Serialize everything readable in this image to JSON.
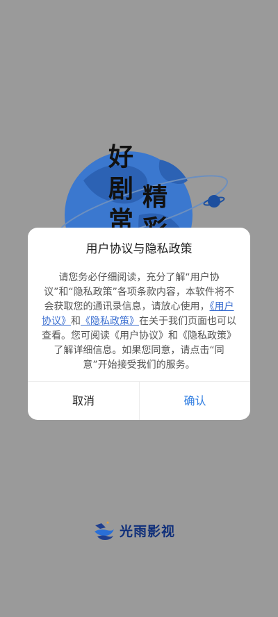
{
  "splash": {
    "slogan_part1": "好剧常",
    "slogan_part2": "精彩"
  },
  "dialog": {
    "title": "用户协议与隐私政策",
    "body_part1": "请您务必仔细阅读，充分了解“用户协议”和“隐私政策”各项条款内容，本软件将不会获取您的通讯录信息，请放心使用，",
    "link_user_agreement": "《用户协议》",
    "body_and": "和",
    "link_privacy_policy": "《隐私政策》",
    "body_part2": "在关于我们页面也可以查看。您可阅读《用户协议》和《隐私政策》了解详细信息。如果您同意，请点击“同意”开始接受我们的服务。",
    "cancel_label": "取消",
    "confirm_label": "确认"
  },
  "brand": {
    "name": "光雨影视",
    "logo_icon": "guangyu-logo-icon"
  },
  "colors": {
    "overlay": "#9a9a9a",
    "globe": "#2f6fc9",
    "confirm": "#2f7de1",
    "link": "#3a6ed0",
    "brand": "#0f2f7a"
  }
}
